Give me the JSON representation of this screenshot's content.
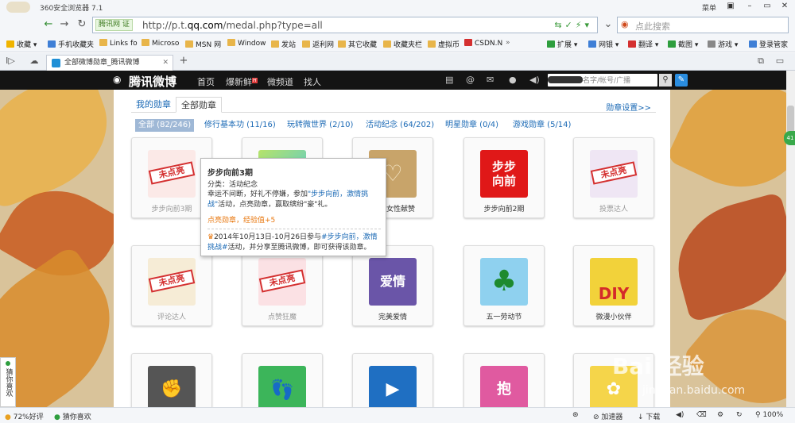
{
  "browser": {
    "app_title": "360安全浏览器 7.1",
    "menu_label": "菜单",
    "address_site_tag": "腾讯网 证",
    "url_prefix": "http://p.t.",
    "url_domain": "qq.com",
    "url_suffix": "/medal.php?type=all",
    "search_placeholder": "点此搜索",
    "bookmarks": [
      "收藏",
      "手机收藏夹",
      "Links fo",
      "Microso",
      "MSN 网",
      "Window",
      "发站",
      "返利网",
      "其它收藏",
      "收藏夹栏",
      "虚拟币",
      "CSDN.N"
    ],
    "tools": [
      "扩展",
      "网银",
      "翻译",
      "截图",
      "游戏",
      "登录管家"
    ],
    "tab_title": "全部微博勋章_腾讯微博",
    "new_tab": "+"
  },
  "weibo_nav": {
    "brand": "腾讯微博",
    "links": [
      "首页",
      "爆新鲜",
      "微频道",
      "找人"
    ],
    "hot_badge": "H",
    "search_placeholder": "名字/帐号/广播"
  },
  "panel": {
    "tabs": [
      "我的勋章",
      "全部勋章"
    ],
    "settings_link": "勋章设置>>",
    "filters": [
      "全部 (82/246)",
      "修行基本功 (11/16)",
      "玩转微世界 (2/10)",
      "活动纪念 (64/202)",
      "明星勋章 (0/4)",
      "游戏勋章 (5/14)"
    ]
  },
  "medals": [
    {
      "label": "步步向前3期",
      "stamp": "未点亮"
    },
    {
      "label": "",
      "art": ""
    },
    {
      "label": "女性献赞",
      "art": ""
    },
    {
      "label": "步步向前2期",
      "art": "步步\n向前"
    },
    {
      "label": "投票达人",
      "stamp": "未点亮"
    },
    {
      "label": "评论达人",
      "stamp": "未点亮"
    },
    {
      "label": "点赞狂魔",
      "stamp": "未点亮"
    },
    {
      "label": "完美爱情",
      "art": "爱情"
    },
    {
      "label": "五一劳动节",
      "art": "♣"
    },
    {
      "label": "微漫小伙伴",
      "art": "DIY"
    },
    {
      "label": "",
      "art": ""
    },
    {
      "label": "",
      "art": ""
    },
    {
      "label": "",
      "art": ""
    },
    {
      "label": "",
      "art": "抱"
    },
    {
      "label": "",
      "art": ""
    }
  ],
  "tooltip": {
    "title": "步步向前3期",
    "category": "分类：活动纪念",
    "desc_1": "幸运不间断，好礼不停嫌，参加",
    "desc_link": "\"步步向前，激情挑战\"",
    "desc_2": "活动，点亮勋章，赢取缤纷\"豪\"礼。",
    "reward": "点亮勋章，经验值+5",
    "foot_1": "2014年10月13日-10月26日参与",
    "foot_link": "#步步向前，激情挑战#",
    "foot_2": "活动，并分享至腾讯微博，即可获得该勋章。"
  },
  "side_widget": "猜你喜欢",
  "status": {
    "rating": "72%好评",
    "guess": "猜你喜欢",
    "accelerator": "加速器",
    "download": "下载",
    "zoom": "100%"
  },
  "watermark": {
    "main": "Bai 经验",
    "sub": "jingyan.baidu.com"
  },
  "colors": {
    "accent_blue": "#1a69b5",
    "brand_gold": "#f2c53d",
    "nav_bg": "#141414",
    "green": "#39a94a"
  }
}
